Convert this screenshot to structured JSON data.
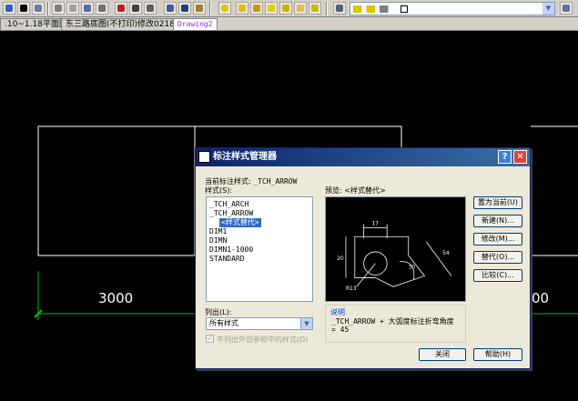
{
  "tabs": [
    {
      "label": ".10~1.18平面图",
      "active": false
    },
    {
      "label": "东三路底图(不打印)修改0218",
      "active": false
    },
    {
      "label": "Drawing2",
      "active": true
    }
  ],
  "drawing": {
    "dimension_left": "3000",
    "dimension_right": "00"
  },
  "dialog": {
    "title": "标注样式管理器",
    "current_style_label": "当前标注样式:",
    "current_style_value": "_TCH_ARROW",
    "styles_label": "样式(S):",
    "styles": [
      "_TCH_ARCH",
      "_TCH_ARROW",
      "<样式替代>",
      "DIM1",
      "DIMN",
      "DIMN1-1000",
      "STANDARD"
    ],
    "selected_style": "<样式替代>",
    "preview_label": "预览: <样式替代>",
    "preview_dims": {
      "d17": "17",
      "d20": "20",
      "d54": "54",
      "d30": "30",
      "r13": "R13"
    },
    "buttons": {
      "set_current": "置为当前(U)",
      "new": "新建(N)...",
      "modify": "修改(M)...",
      "override": "替代(O)...",
      "compare": "比较(C)...",
      "close": "关闭",
      "help": "帮助(H)"
    },
    "list_label": "列出(L):",
    "list_value": "所有样式",
    "xref_label": "不列出外部参照中的样式(D)",
    "description_title": "说明",
    "description_text": "_TCH_ARROW + 大弧度标注折弯角度 = 45",
    "help_glyph": "?",
    "close_glyph": "✕"
  },
  "colors": {
    "canvas": "#000000",
    "drawing_line": "#ffffff",
    "dimension_line": "#00c000",
    "selection": "#316ac5",
    "titlebar": "#0a246a"
  }
}
